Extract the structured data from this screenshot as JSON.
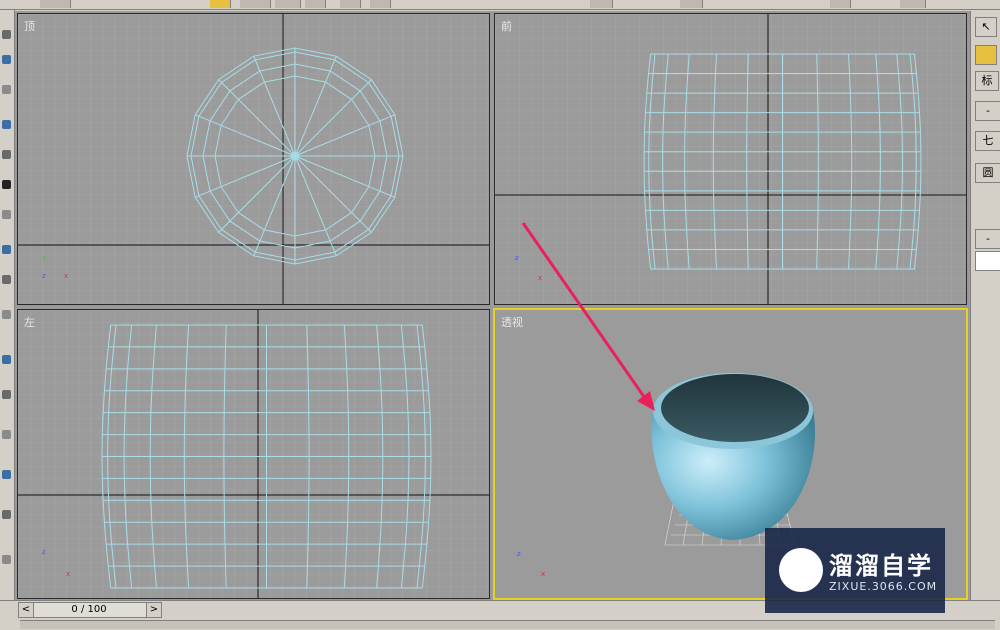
{
  "viewports": {
    "top": {
      "label": "顶"
    },
    "front": {
      "label": "前"
    },
    "left": {
      "label": "左"
    },
    "perspective": {
      "label": "透视"
    }
  },
  "axis_labels": {
    "x": "x",
    "y": "y",
    "z": "z"
  },
  "right_panel": {
    "tab_label": "标",
    "minus_1": "-",
    "btn_1": "七",
    "btn_2": "圆",
    "btn_3": "-"
  },
  "timeline": {
    "frame_display": "0 / 100",
    "prev_label": "<",
    "next_label": ">"
  },
  "watermark": {
    "title": "溜溜自学",
    "subtitle": "ZIXUE.3066.COM"
  },
  "colors": {
    "wire": "#a8dde8",
    "viewport_bg": "#9b9b9b",
    "active_border": "#e6d21e",
    "arrow": "#e8215c"
  }
}
